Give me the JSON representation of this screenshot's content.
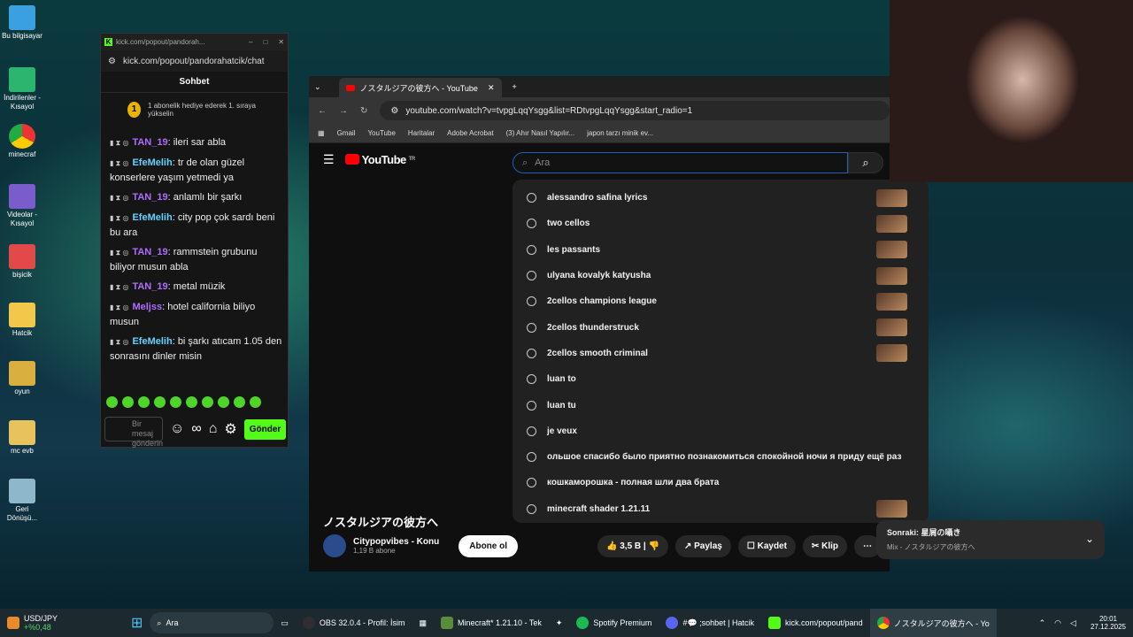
{
  "desktop": {
    "icons": [
      "Bu bilgisayar",
      "İndirilenler - Kısayol",
      "minecraf",
      "Videolar - Kısayol",
      "bişicik",
      "Hatcik",
      "oyun",
      "mc evb",
      "Geri Dönüşü..."
    ]
  },
  "kick": {
    "window_title": "kick.com/popout/pandorah...",
    "url": "kick.com/popout/pandorahatcik/chat",
    "header": "Sohbet",
    "gift_num": "1",
    "gift_text": "1 abonelik hediye ederek 1. sıraya yükselin",
    "messages": [
      {
        "user": "TAN_19",
        "color": "#b06cff",
        "text": "ileri sar abla"
      },
      {
        "user": "EfeMelih",
        "color": "#64d2ff",
        "text": "tr de olan güzel konserlere yaşım yetmedi ya"
      },
      {
        "user": "TAN_19",
        "color": "#b06cff",
        "text": "anlamlı bir şarkı"
      },
      {
        "user": "EfeMelih",
        "color": "#64d2ff",
        "text": "city pop çok sardı beni bu ara"
      },
      {
        "user": "TAN_19",
        "color": "#b06cff",
        "text": "rammstein grubunu biliyor musun abla"
      },
      {
        "user": "TAN_19",
        "color": "#b06cff",
        "text": "metal müzik"
      },
      {
        "user": "Meljss",
        "color": "#b06cff",
        "text": "hotel california biliyo musun"
      },
      {
        "user": "EfeMelih",
        "color": "#64d2ff",
        "text": "bi şarkı atıcam 1.05 den sonrasını dinler misin"
      }
    ],
    "input_placeholder": "Bir mesaj gönderin",
    "send": "Gönder"
  },
  "browser": {
    "tab_title": "ノスタルジアの彼方へ - YouTube",
    "url": "youtube.com/watch?v=tvpgLqqYsgg&list=RDtvpgLqqYsgg&start_radio=1",
    "bookmarks": [
      "Gmail",
      "YouTube",
      "Haritalar",
      "Adobe Acrobat",
      "(3) Ahır Nasıl Yapılır...",
      "japon tarzı minik ev..."
    ]
  },
  "youtube": {
    "logo": "YouTube",
    "logo_sup": "TR",
    "search_placeholder": "Ara",
    "suggestions": [
      "alessandro safina lyrics",
      "two cellos",
      "les passants",
      "ulyana kovalyk katyusha",
      "2cellos champions league",
      "2cellos thunderstruck",
      "2cellos smooth criminal",
      "luan to",
      "luan tu",
      "je veux",
      "ольшое спасибо было приятно познакомиться спокойной ночи я приду ещё раз",
      "кошкаморошка - полная шли два брата",
      "minecraft shader 1.21.11"
    ],
    "video_title": "ノスタルジアの彼方へ",
    "channel": "Citypopvibes - Konu",
    "subs": "1,19 B abone",
    "subscribe": "Abone ol",
    "likes": "3,5 B",
    "share": "Paylaş",
    "save": "Kaydet",
    "clip": "Klip",
    "next_title": "Sonraki: 星屑の囁き",
    "next_sub": "Mix - ノスタルジアの彼方へ"
  },
  "taskbar": {
    "currency": "USD/JPY",
    "change": "+%0,48",
    "search": "Ara",
    "apps": [
      "OBS 32.0.4 - Profil: İsim",
      "Minecraft* 1.21.10 - Tek",
      "Spotify Premium",
      "#💬 ;sohbet | Hatcik",
      "kick.com/popout/pand",
      "ノスタルジアの彼方へ - Yo"
    ],
    "time": "20:01",
    "date": "27.12.2025"
  }
}
